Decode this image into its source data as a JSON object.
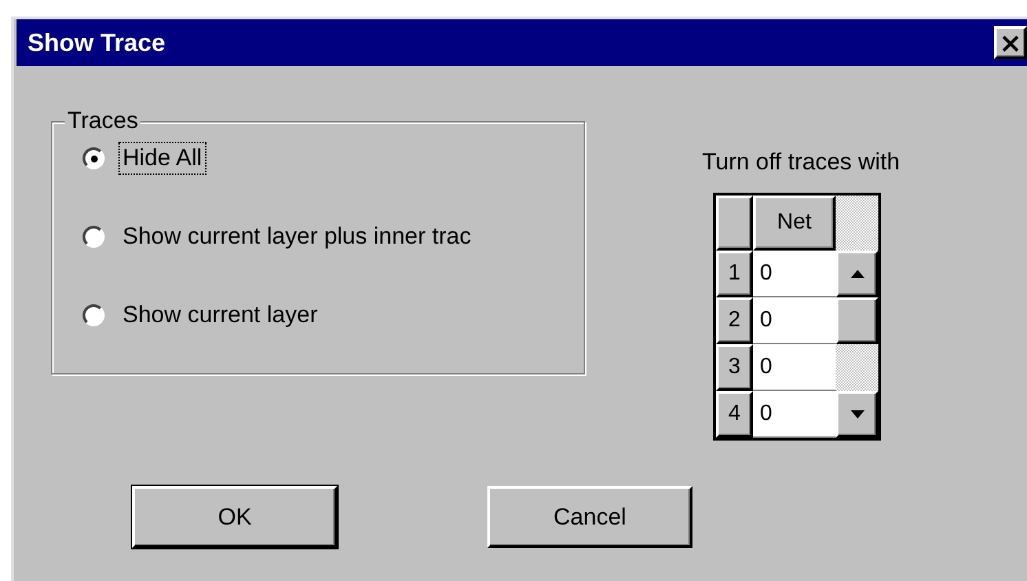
{
  "window": {
    "title": "Show Trace",
    "close": "×"
  },
  "traces_group": {
    "legend": "Traces",
    "options": [
      {
        "label": "Hide All",
        "selected": true,
        "focused": true
      },
      {
        "label": "Show current layer plus inner trac",
        "selected": false,
        "focused": false
      },
      {
        "label": "Show current layer",
        "selected": false,
        "focused": false
      }
    ]
  },
  "filter": {
    "label": "Turn off traces with",
    "columns": [
      "Net"
    ],
    "rows": [
      {
        "number": "1",
        "net": "0"
      },
      {
        "number": "2",
        "net": "0"
      },
      {
        "number": "3",
        "net": "0"
      },
      {
        "number": "4",
        "net": "0"
      }
    ]
  },
  "buttons": [
    {
      "label": "OK",
      "default": true
    },
    {
      "label": "Cancel",
      "default": false
    }
  ]
}
